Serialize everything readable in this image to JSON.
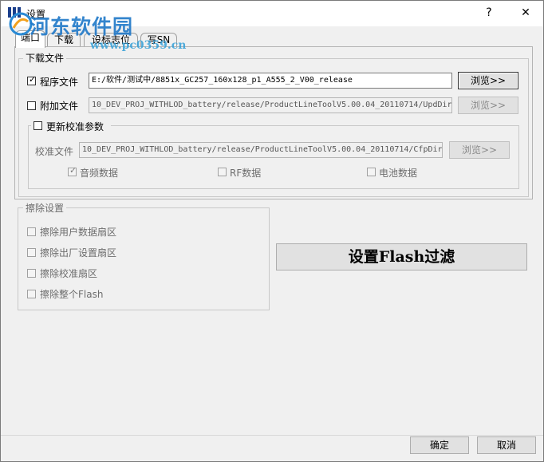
{
  "window": {
    "title": "设置",
    "help_glyph": "?",
    "close_glyph": "✕"
  },
  "watermark": {
    "text": "河东软件园",
    "url": "www.pc0359.cn"
  },
  "tabs": [
    {
      "label": "端口",
      "active": true
    },
    {
      "label": "下载",
      "active": false
    },
    {
      "label": "设标志位",
      "active": false
    },
    {
      "label": "写SN",
      "active": false
    }
  ],
  "download_group": {
    "title": "下载文件",
    "program_file": {
      "label": "程序文件",
      "checked": true,
      "value": "E:/软件/测试中/8851x_GC257_160x128_p1_A555_2_V00_release",
      "browse": "浏览>>"
    },
    "extra_file": {
      "label": "附加文件",
      "checked": false,
      "value": "10_DEV_PROJ_WITHLOD_battery/release/ProductLineToolV5.00.04_20110714/UpdDir",
      "browse": "浏览>>"
    }
  },
  "calib_group": {
    "title": "更新校准参数",
    "checked": false,
    "calib_file": {
      "label": "校准文件",
      "value": "10_DEV_PROJ_WITHLOD_battery/release/ProductLineToolV5.00.04_20110714/CfpDir",
      "browse": "浏览>>"
    },
    "options": [
      {
        "label": "音频数据",
        "checked": true
      },
      {
        "label": "RF数据",
        "checked": false
      },
      {
        "label": "电池数据",
        "checked": false
      }
    ]
  },
  "erase_group": {
    "title": "擦除设置",
    "items": [
      {
        "label": "擦除用户数据扇区",
        "checked": false
      },
      {
        "label": "擦除出厂设置扇区",
        "checked": false
      },
      {
        "label": "擦除校准扇区",
        "checked": false
      },
      {
        "label": "擦除整个Flash",
        "checked": false
      }
    ]
  },
  "flash_filter_button": "设置Flash过滤",
  "footer": {
    "ok": "确定",
    "cancel": "取消"
  }
}
